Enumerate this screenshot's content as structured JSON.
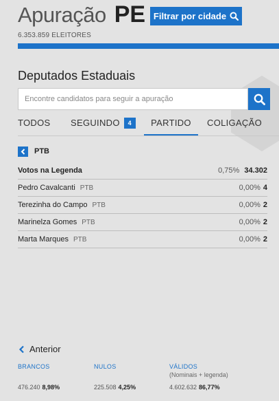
{
  "header": {
    "title": "Apuração",
    "uf": "PE",
    "filter_button": "Filtrar por cidade",
    "electors": "6.353.859 ELEITORES"
  },
  "section": {
    "title": "Deputados Estaduais",
    "search_placeholder": "Encontre candidatos para seguir a apuração"
  },
  "tabs": [
    {
      "label": "TODOS"
    },
    {
      "label": "SEGUINDO",
      "badge": "4"
    },
    {
      "label": "PARTIDO",
      "active": true
    },
    {
      "label": "COLIGAÇÃO"
    }
  ],
  "party": {
    "name": "PTB"
  },
  "legend_votes": {
    "label": "Votos na Legenda",
    "pct": "0,75%",
    "votes": "34.302"
  },
  "candidates": [
    {
      "name": "Pedro Cavalcanti",
      "party": "PTB",
      "pct": "0,00%",
      "votes": "4"
    },
    {
      "name": "Terezinha do Campo",
      "party": "PTB",
      "pct": "0,00%",
      "votes": "2"
    },
    {
      "name": "Marinelza Gomes",
      "party": "PTB",
      "pct": "0,00%",
      "votes": "2"
    },
    {
      "name": "Marta Marques",
      "party": "PTB",
      "pct": "0,00%",
      "votes": "2"
    }
  ],
  "pagination": {
    "previous": "Anterior"
  },
  "stats": {
    "brancos": {
      "label": "BRANCOS",
      "value": "476.240",
      "pct": "8,98%"
    },
    "nulos": {
      "label": "NULOS",
      "value": "225.508",
      "pct": "4,25%"
    },
    "validos": {
      "label": "VÁLIDOS",
      "sub": "(Nominais + legenda)",
      "value": "4.602.632",
      "pct": "86,77%"
    }
  },
  "colors": {
    "accent": "#1d73c9",
    "background": "#e3e3e3"
  },
  "icons": {
    "filter": "search-icon",
    "search": "search-icon",
    "back": "chevron-left-icon"
  }
}
